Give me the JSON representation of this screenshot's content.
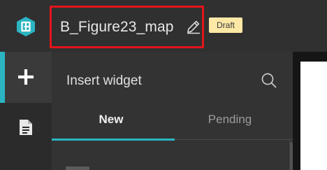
{
  "header": {
    "title": "B_Figure23_map",
    "status_badge": "Draft",
    "accent_color": "#2bb5c3",
    "highlight_color": "#e4141b",
    "badge_color": "#fde8a6",
    "logo_icon": "app-logo-icon",
    "edit_icon": "pencil-edit-icon"
  },
  "rail": {
    "items": [
      {
        "icon": "plus-icon",
        "selected": true
      },
      {
        "icon": "page-icon",
        "selected": false
      }
    ]
  },
  "panel": {
    "title": "Insert widget",
    "search_icon": "search-icon",
    "tabs": [
      {
        "label": "New",
        "selected": true
      },
      {
        "label": "Pending",
        "selected": false
      }
    ]
  }
}
